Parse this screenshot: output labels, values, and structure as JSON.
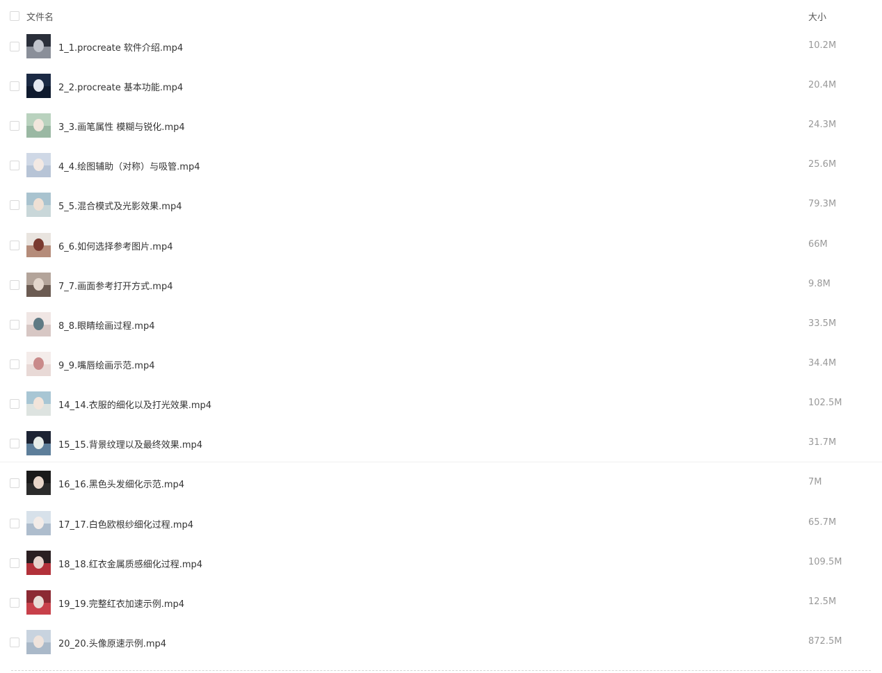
{
  "header": {
    "name_label": "文件名",
    "size_label": "大小"
  },
  "files": [
    {
      "name": "1_1.procreate 软件介绍.mp4",
      "size": "10.2M",
      "thumb_colors": [
        "#2a2f3a",
        "#8a8f99",
        "#c0c4cc"
      ]
    },
    {
      "name": "2_2.procreate 基本功能.mp4",
      "size": "20.4M",
      "thumb_colors": [
        "#1b2a44",
        "#0f1a2e",
        "#e4e8f0"
      ]
    },
    {
      "name": "3_3.画笔属性 模糊与锐化.mp4",
      "size": "24.3M",
      "thumb_colors": [
        "#b9d2be",
        "#9ab8a3",
        "#f1e6dc"
      ]
    },
    {
      "name": "4_4.绘图辅助（对称）与吸管.mp4",
      "size": "25.6M",
      "thumb_colors": [
        "#cfd8e6",
        "#b7c4d6",
        "#f3e9e3"
      ]
    },
    {
      "name": "5_5.混合模式及光影效果.mp4",
      "size": "79.3M",
      "thumb_colors": [
        "#a9c3cf",
        "#c9d7d9",
        "#efe0d4"
      ]
    },
    {
      "name": "6_6.如何选择参考图片.mp4",
      "size": "66M",
      "thumb_colors": [
        "#e9e4df",
        "#b58c7a",
        "#7a3a30"
      ]
    },
    {
      "name": "7_7.画面参考打开方式.mp4",
      "size": "9.8M",
      "thumb_colors": [
        "#b3a49a",
        "#6b5b52",
        "#e3d6cc"
      ]
    },
    {
      "name": "8_8.眼睛绘画过程.mp4",
      "size": "33.5M",
      "thumb_colors": [
        "#f0e6e4",
        "#d7c7c4",
        "#5f7a84"
      ]
    },
    {
      "name": "9_9.嘴唇绘画示范.mp4",
      "size": "34.4M",
      "thumb_colors": [
        "#f4ecea",
        "#e8d9d6",
        "#c98a8a"
      ]
    },
    {
      "name": "14_14.衣服的细化以及打光效果.mp4",
      "size": "102.5M",
      "thumb_colors": [
        "#a8c6d4",
        "#dde3e0",
        "#f2e4da"
      ]
    },
    {
      "name": "15_15.背景纹理以及最终效果.mp4",
      "size": "31.7M",
      "thumb_colors": [
        "#1c2333",
        "#5d7e9a",
        "#e6ece9"
      ]
    },
    {
      "name": "16_16.黑色头发细化示范.mp4",
      "size": "7M",
      "thumb_colors": [
        "#1a1a1a",
        "#2b2b2b",
        "#e8d6c9"
      ]
    },
    {
      "name": "17_17.白色欧根纱细化过程.mp4",
      "size": "65.7M",
      "thumb_colors": [
        "#d7e1ea",
        "#aebdcd",
        "#f3ece8"
      ]
    },
    {
      "name": "18_18.红衣金属质感细化过程.mp4",
      "size": "109.5M",
      "thumb_colors": [
        "#2a1f22",
        "#b2313a",
        "#e7d3cc"
      ]
    },
    {
      "name": "19_19.完整红衣加速示例.mp4",
      "size": "12.5M",
      "thumb_colors": [
        "#8c2a33",
        "#c8404a",
        "#e9dcd6"
      ]
    },
    {
      "name": "20_20.头像原速示例.mp4",
      "size": "872.5M",
      "thumb_colors": [
        "#c8d3df",
        "#aab9c9",
        "#efe3dc"
      ]
    }
  ]
}
